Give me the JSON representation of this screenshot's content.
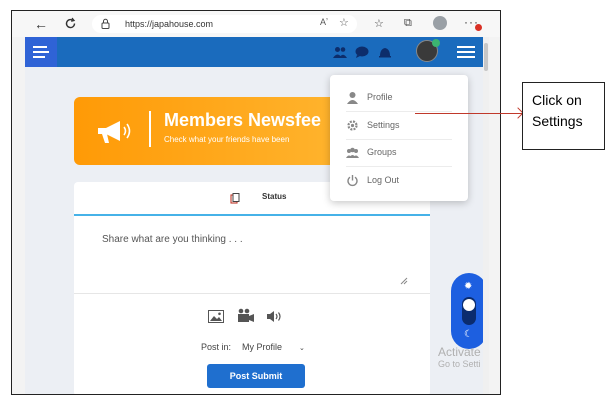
{
  "browser": {
    "url": "https://japahouse.com",
    "read_aloud_label": "Aʼ",
    "icons": [
      "back-arrow-icon",
      "refresh-icon",
      "lock-icon",
      "read-aloud-icon",
      "favorite-icon",
      "favorites-bar-icon",
      "collections-icon",
      "profile-icon",
      "more-icon"
    ]
  },
  "header": {
    "icons": [
      "menu-icon",
      "friends-icon",
      "messages-icon",
      "notifications-icon",
      "avatar",
      "hamburger-icon"
    ],
    "accent": "#1a6bbd"
  },
  "banner": {
    "title": "Members Newsfee",
    "subtitle": "Check what your friends have been",
    "gradient": [
      "#ff9a06",
      "#ffb42e"
    ]
  },
  "post": {
    "tab_label": "Status",
    "placeholder": "Share what are you thinking . . .",
    "post_in_label": "Post in:",
    "post_in_value": "My Profile",
    "submit_label": "Post Submit",
    "media_icons": [
      "photo-icon",
      "video-icon",
      "audio-icon"
    ]
  },
  "dropdown": {
    "items": [
      {
        "label": "Profile",
        "icon": "user-icon"
      },
      {
        "label": "Settings",
        "icon": "gear-icon"
      },
      {
        "label": "Groups",
        "icon": "group-icon"
      },
      {
        "label": "Log Out",
        "icon": "power-icon"
      }
    ]
  },
  "theme_toggle": {
    "icons": [
      "sun-icon",
      "moon-icon"
    ],
    "color": "#1d5fe0"
  },
  "watermark": {
    "line1": "Activate",
    "line2": "Go to Setti"
  },
  "annotation": {
    "line1": "Click on",
    "line2": "Settings"
  }
}
